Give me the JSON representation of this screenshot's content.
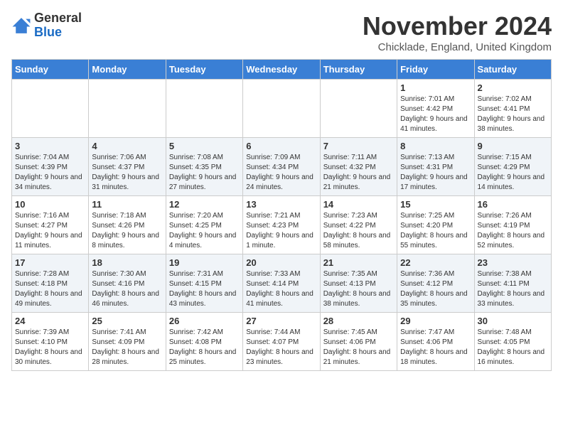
{
  "logo": {
    "general": "General",
    "blue": "Blue"
  },
  "header": {
    "month_title": "November 2024",
    "location": "Chicklade, England, United Kingdom"
  },
  "weekdays": [
    "Sunday",
    "Monday",
    "Tuesday",
    "Wednesday",
    "Thursday",
    "Friday",
    "Saturday"
  ],
  "weeks": [
    [
      {
        "day": "",
        "info": ""
      },
      {
        "day": "",
        "info": ""
      },
      {
        "day": "",
        "info": ""
      },
      {
        "day": "",
        "info": ""
      },
      {
        "day": "",
        "info": ""
      },
      {
        "day": "1",
        "info": "Sunrise: 7:01 AM\nSunset: 4:42 PM\nDaylight: 9 hours and 41 minutes."
      },
      {
        "day": "2",
        "info": "Sunrise: 7:02 AM\nSunset: 4:41 PM\nDaylight: 9 hours and 38 minutes."
      }
    ],
    [
      {
        "day": "3",
        "info": "Sunrise: 7:04 AM\nSunset: 4:39 PM\nDaylight: 9 hours and 34 minutes."
      },
      {
        "day": "4",
        "info": "Sunrise: 7:06 AM\nSunset: 4:37 PM\nDaylight: 9 hours and 31 minutes."
      },
      {
        "day": "5",
        "info": "Sunrise: 7:08 AM\nSunset: 4:35 PM\nDaylight: 9 hours and 27 minutes."
      },
      {
        "day": "6",
        "info": "Sunrise: 7:09 AM\nSunset: 4:34 PM\nDaylight: 9 hours and 24 minutes."
      },
      {
        "day": "7",
        "info": "Sunrise: 7:11 AM\nSunset: 4:32 PM\nDaylight: 9 hours and 21 minutes."
      },
      {
        "day": "8",
        "info": "Sunrise: 7:13 AM\nSunset: 4:31 PM\nDaylight: 9 hours and 17 minutes."
      },
      {
        "day": "9",
        "info": "Sunrise: 7:15 AM\nSunset: 4:29 PM\nDaylight: 9 hours and 14 minutes."
      }
    ],
    [
      {
        "day": "10",
        "info": "Sunrise: 7:16 AM\nSunset: 4:27 PM\nDaylight: 9 hours and 11 minutes."
      },
      {
        "day": "11",
        "info": "Sunrise: 7:18 AM\nSunset: 4:26 PM\nDaylight: 9 hours and 8 minutes."
      },
      {
        "day": "12",
        "info": "Sunrise: 7:20 AM\nSunset: 4:25 PM\nDaylight: 9 hours and 4 minutes."
      },
      {
        "day": "13",
        "info": "Sunrise: 7:21 AM\nSunset: 4:23 PM\nDaylight: 9 hours and 1 minute."
      },
      {
        "day": "14",
        "info": "Sunrise: 7:23 AM\nSunset: 4:22 PM\nDaylight: 8 hours and 58 minutes."
      },
      {
        "day": "15",
        "info": "Sunrise: 7:25 AM\nSunset: 4:20 PM\nDaylight: 8 hours and 55 minutes."
      },
      {
        "day": "16",
        "info": "Sunrise: 7:26 AM\nSunset: 4:19 PM\nDaylight: 8 hours and 52 minutes."
      }
    ],
    [
      {
        "day": "17",
        "info": "Sunrise: 7:28 AM\nSunset: 4:18 PM\nDaylight: 8 hours and 49 minutes."
      },
      {
        "day": "18",
        "info": "Sunrise: 7:30 AM\nSunset: 4:16 PM\nDaylight: 8 hours and 46 minutes."
      },
      {
        "day": "19",
        "info": "Sunrise: 7:31 AM\nSunset: 4:15 PM\nDaylight: 8 hours and 43 minutes."
      },
      {
        "day": "20",
        "info": "Sunrise: 7:33 AM\nSunset: 4:14 PM\nDaylight: 8 hours and 41 minutes."
      },
      {
        "day": "21",
        "info": "Sunrise: 7:35 AM\nSunset: 4:13 PM\nDaylight: 8 hours and 38 minutes."
      },
      {
        "day": "22",
        "info": "Sunrise: 7:36 AM\nSunset: 4:12 PM\nDaylight: 8 hours and 35 minutes."
      },
      {
        "day": "23",
        "info": "Sunrise: 7:38 AM\nSunset: 4:11 PM\nDaylight: 8 hours and 33 minutes."
      }
    ],
    [
      {
        "day": "24",
        "info": "Sunrise: 7:39 AM\nSunset: 4:10 PM\nDaylight: 8 hours and 30 minutes."
      },
      {
        "day": "25",
        "info": "Sunrise: 7:41 AM\nSunset: 4:09 PM\nDaylight: 8 hours and 28 minutes."
      },
      {
        "day": "26",
        "info": "Sunrise: 7:42 AM\nSunset: 4:08 PM\nDaylight: 8 hours and 25 minutes."
      },
      {
        "day": "27",
        "info": "Sunrise: 7:44 AM\nSunset: 4:07 PM\nDaylight: 8 hours and 23 minutes."
      },
      {
        "day": "28",
        "info": "Sunrise: 7:45 AM\nSunset: 4:06 PM\nDaylight: 8 hours and 21 minutes."
      },
      {
        "day": "29",
        "info": "Sunrise: 7:47 AM\nSunset: 4:06 PM\nDaylight: 8 hours and 18 minutes."
      },
      {
        "day": "30",
        "info": "Sunrise: 7:48 AM\nSunset: 4:05 PM\nDaylight: 8 hours and 16 minutes."
      }
    ]
  ]
}
